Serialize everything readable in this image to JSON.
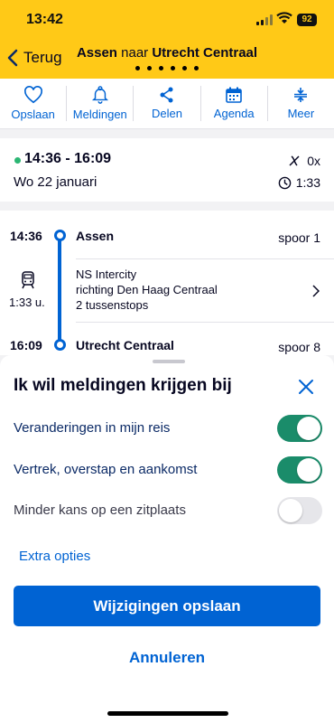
{
  "status_bar": {
    "time": "13:42",
    "battery": "92"
  },
  "header": {
    "back_label": "Terug",
    "origin": "Assen",
    "connector": "naar",
    "destination": "Utrecht Centraal",
    "page_count": 6,
    "active_page": 0
  },
  "actions": [
    {
      "label": "Opslaan",
      "icon": "heart-icon"
    },
    {
      "label": "Meldingen",
      "icon": "bell-icon"
    },
    {
      "label": "Delen",
      "icon": "share-icon"
    },
    {
      "label": "Agenda",
      "icon": "calendar-icon"
    },
    {
      "label": "Meer",
      "icon": "more-icon"
    }
  ],
  "summary": {
    "times": "14:36 - 16:09",
    "date": "Wo 22 januari",
    "transfers": "0x",
    "duration": "1:33"
  },
  "journey": {
    "departure": {
      "time": "14:36",
      "station": "Assen",
      "track": "spoor 1"
    },
    "train": {
      "line1": "NS Intercity",
      "line2": "richting Den Haag Centraal",
      "line3": "2 tussenstops",
      "duration": "1:33 u."
    },
    "arrival": {
      "time": "16:09",
      "station": "Utrecht Centraal",
      "track": "spoor 8"
    }
  },
  "sheet": {
    "title": "Ik wil meldingen krijgen bij",
    "options": [
      {
        "label": "Veranderingen in mijn reis",
        "enabled": true
      },
      {
        "label": "Vertrek, overstap en aankomst",
        "enabled": true
      },
      {
        "label": "Minder kans op een zitplaats",
        "enabled": false
      }
    ],
    "extra_label": "Extra opties",
    "save_label": "Wijzigingen opslaan",
    "cancel_label": "Annuleren"
  },
  "colors": {
    "header_bg": "#ffc917",
    "primary_blue": "#0063d3",
    "toggle_on": "#1a8c6a",
    "text_dark": "#070721"
  }
}
